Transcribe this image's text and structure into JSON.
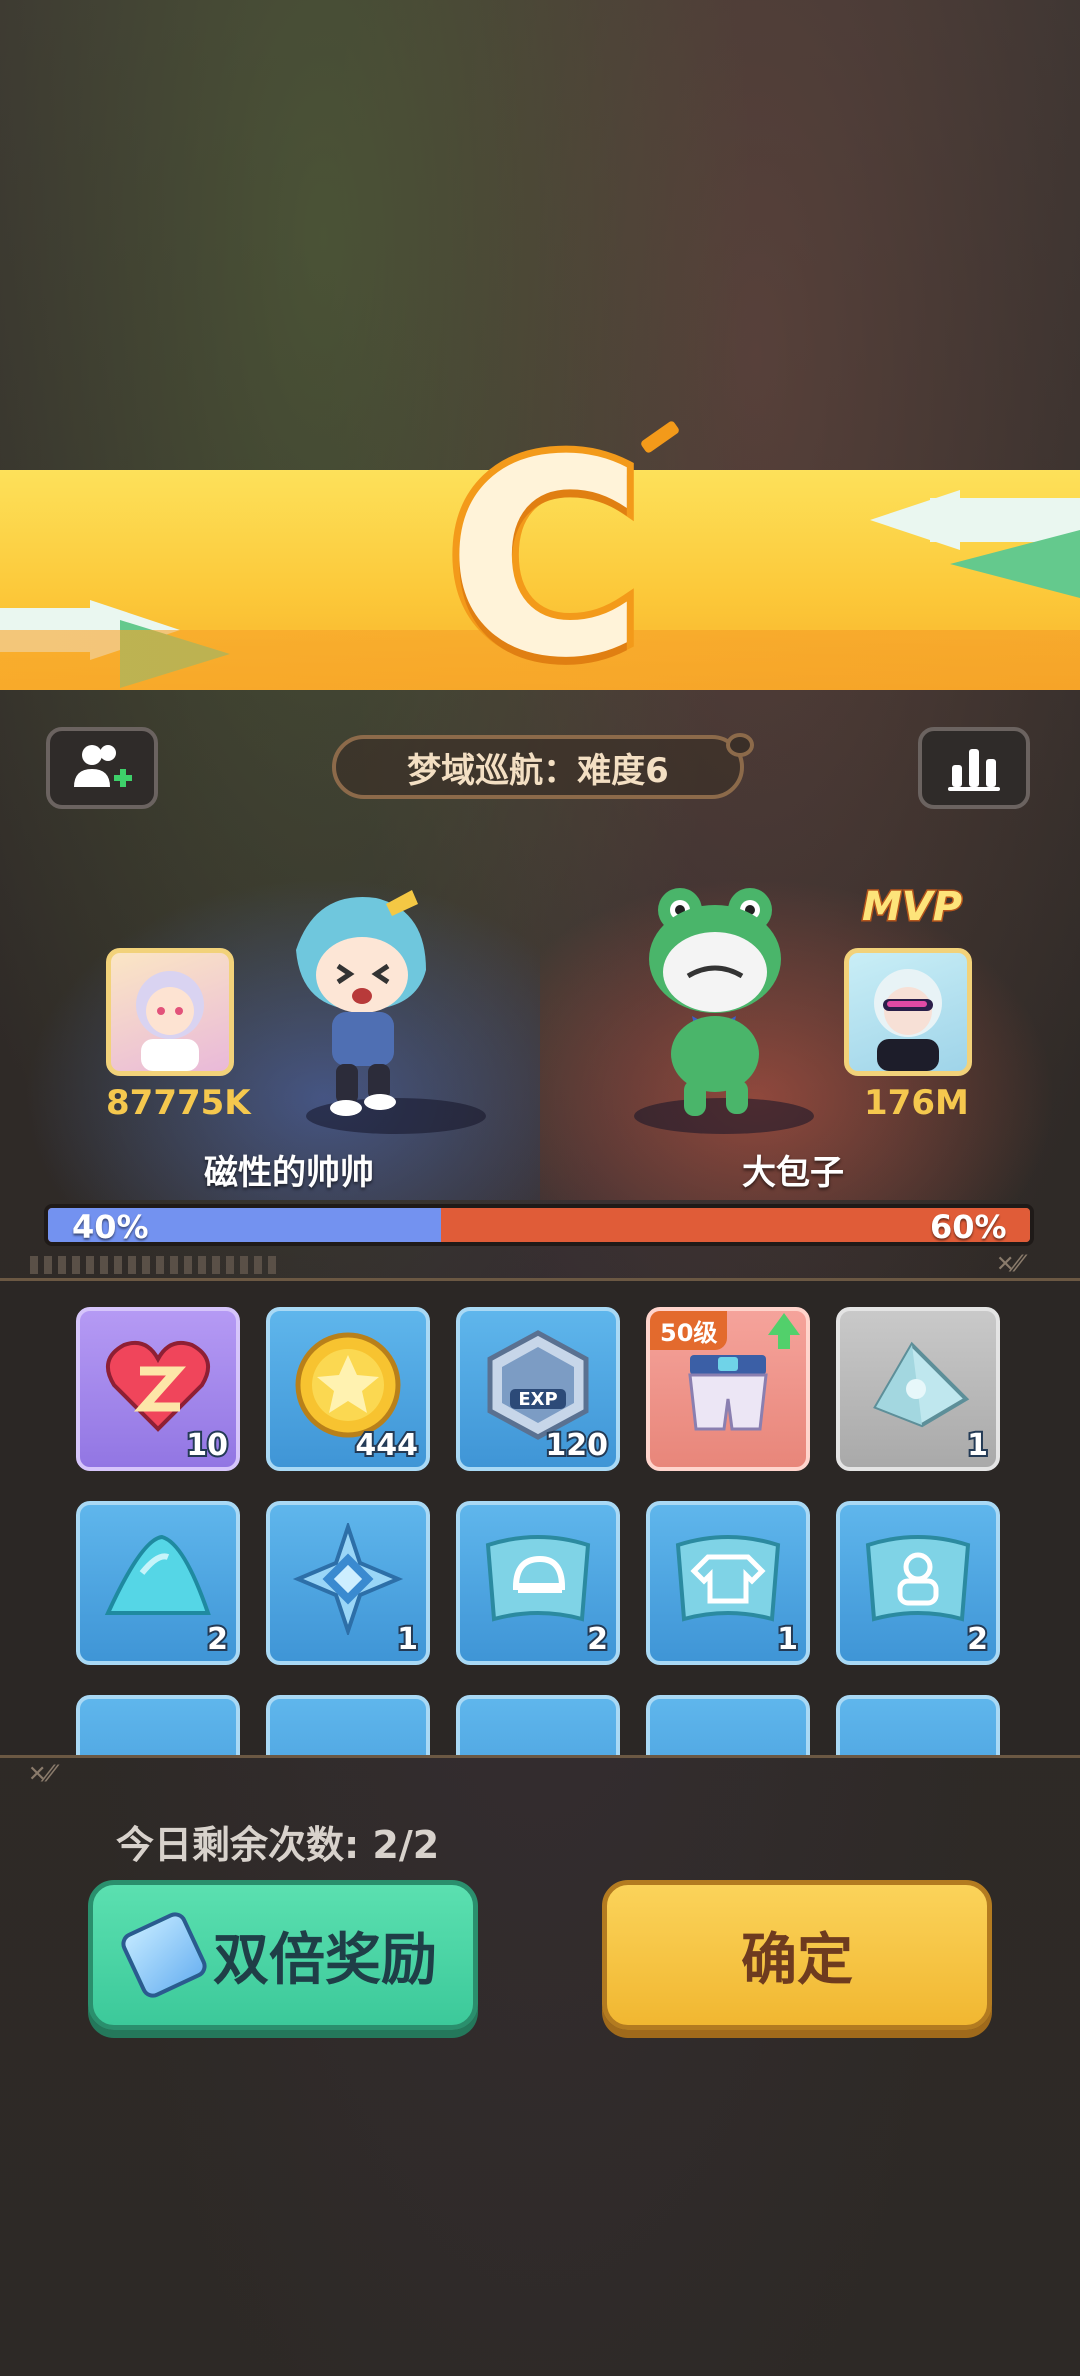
{
  "grade": "C",
  "mode_label": "梦域巡航：难度6",
  "left_player": {
    "score": "87775K",
    "name": "磁性的帅帅",
    "percent": "40%"
  },
  "right_player": {
    "score": "176M",
    "name": "大包子",
    "percent": "60%",
    "badge": "MVP"
  },
  "progress": {
    "left_fraction": 0.4,
    "right_fraction": 0.6
  },
  "rewards": [
    {
      "icon": "heart-z-icon",
      "qty": "10",
      "style": "purple"
    },
    {
      "icon": "gold-coin-icon",
      "qty": "444",
      "style": "blue"
    },
    {
      "icon": "exp-badge-icon",
      "qty": "120",
      "style": "blue"
    },
    {
      "icon": "shorts-equipment-icon",
      "qty": "",
      "style": "pink",
      "level": "50级"
    },
    {
      "icon": "crystal-shard-icon",
      "qty": "1",
      "style": "gray"
    },
    {
      "icon": "blue-sand-pile-icon",
      "qty": "2",
      "style": "blue"
    },
    {
      "icon": "blue-crystal-star-icon",
      "qty": "1",
      "style": "blue"
    },
    {
      "icon": "helmet-blueprint-icon",
      "qty": "2",
      "style": "blue"
    },
    {
      "icon": "clothes-blueprint-icon",
      "qty": "1",
      "style": "blue"
    },
    {
      "icon": "accessory-blueprint-icon",
      "qty": "2",
      "style": "blue"
    }
  ],
  "remaining_label": "今日剩余次数: 2/2",
  "buttons": {
    "double": "双倍奖励",
    "confirm": "确定"
  },
  "colors": {
    "blue_team": "#7392f0",
    "red_team": "#e05c38",
    "banner": "#fcc93a",
    "accent_green": "#3cc99a"
  }
}
